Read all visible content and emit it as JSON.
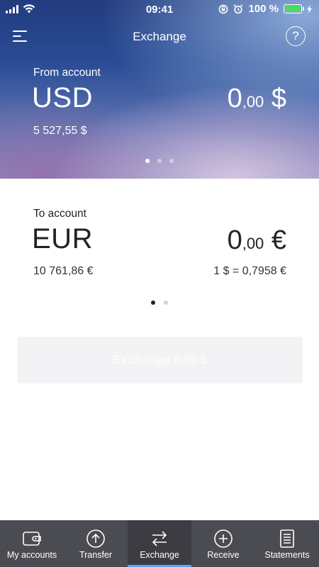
{
  "status_bar": {
    "time": "09:41",
    "battery": "100 %",
    "battery_level": 1.0
  },
  "nav": {
    "title": "Exchange",
    "help_label": "?"
  },
  "from_account": {
    "label": "From account",
    "currency": "USD",
    "amount_int": "0",
    "amount_dec": ",00",
    "amount_symbol": " $",
    "balance": "5 527,55 $"
  },
  "to_account": {
    "label": "To account",
    "currency": "EUR",
    "amount_int": "0",
    "amount_dec": ",00",
    "amount_symbol": " €",
    "balance": "10 761,86 €",
    "rate": "1 $ = 0,7958 €"
  },
  "exchange_button": {
    "label": "Exchange 0,00 $"
  },
  "tabs": [
    {
      "label": "My accounts",
      "icon": "wallet-icon",
      "active": false
    },
    {
      "label": "Transfer",
      "icon": "arrow-up-circle-icon",
      "active": false
    },
    {
      "label": "Exchange",
      "icon": "exchange-arrows-icon",
      "active": true
    },
    {
      "label": "Receive",
      "icon": "plus-circle-icon",
      "active": false
    },
    {
      "label": "Statements",
      "icon": "document-list-icon",
      "active": false
    }
  ],
  "colors": {
    "tab_active_indicator": "#5ea2f0",
    "tabbar_bg": "#4b4b52",
    "battery_fill": "#4cd964"
  }
}
